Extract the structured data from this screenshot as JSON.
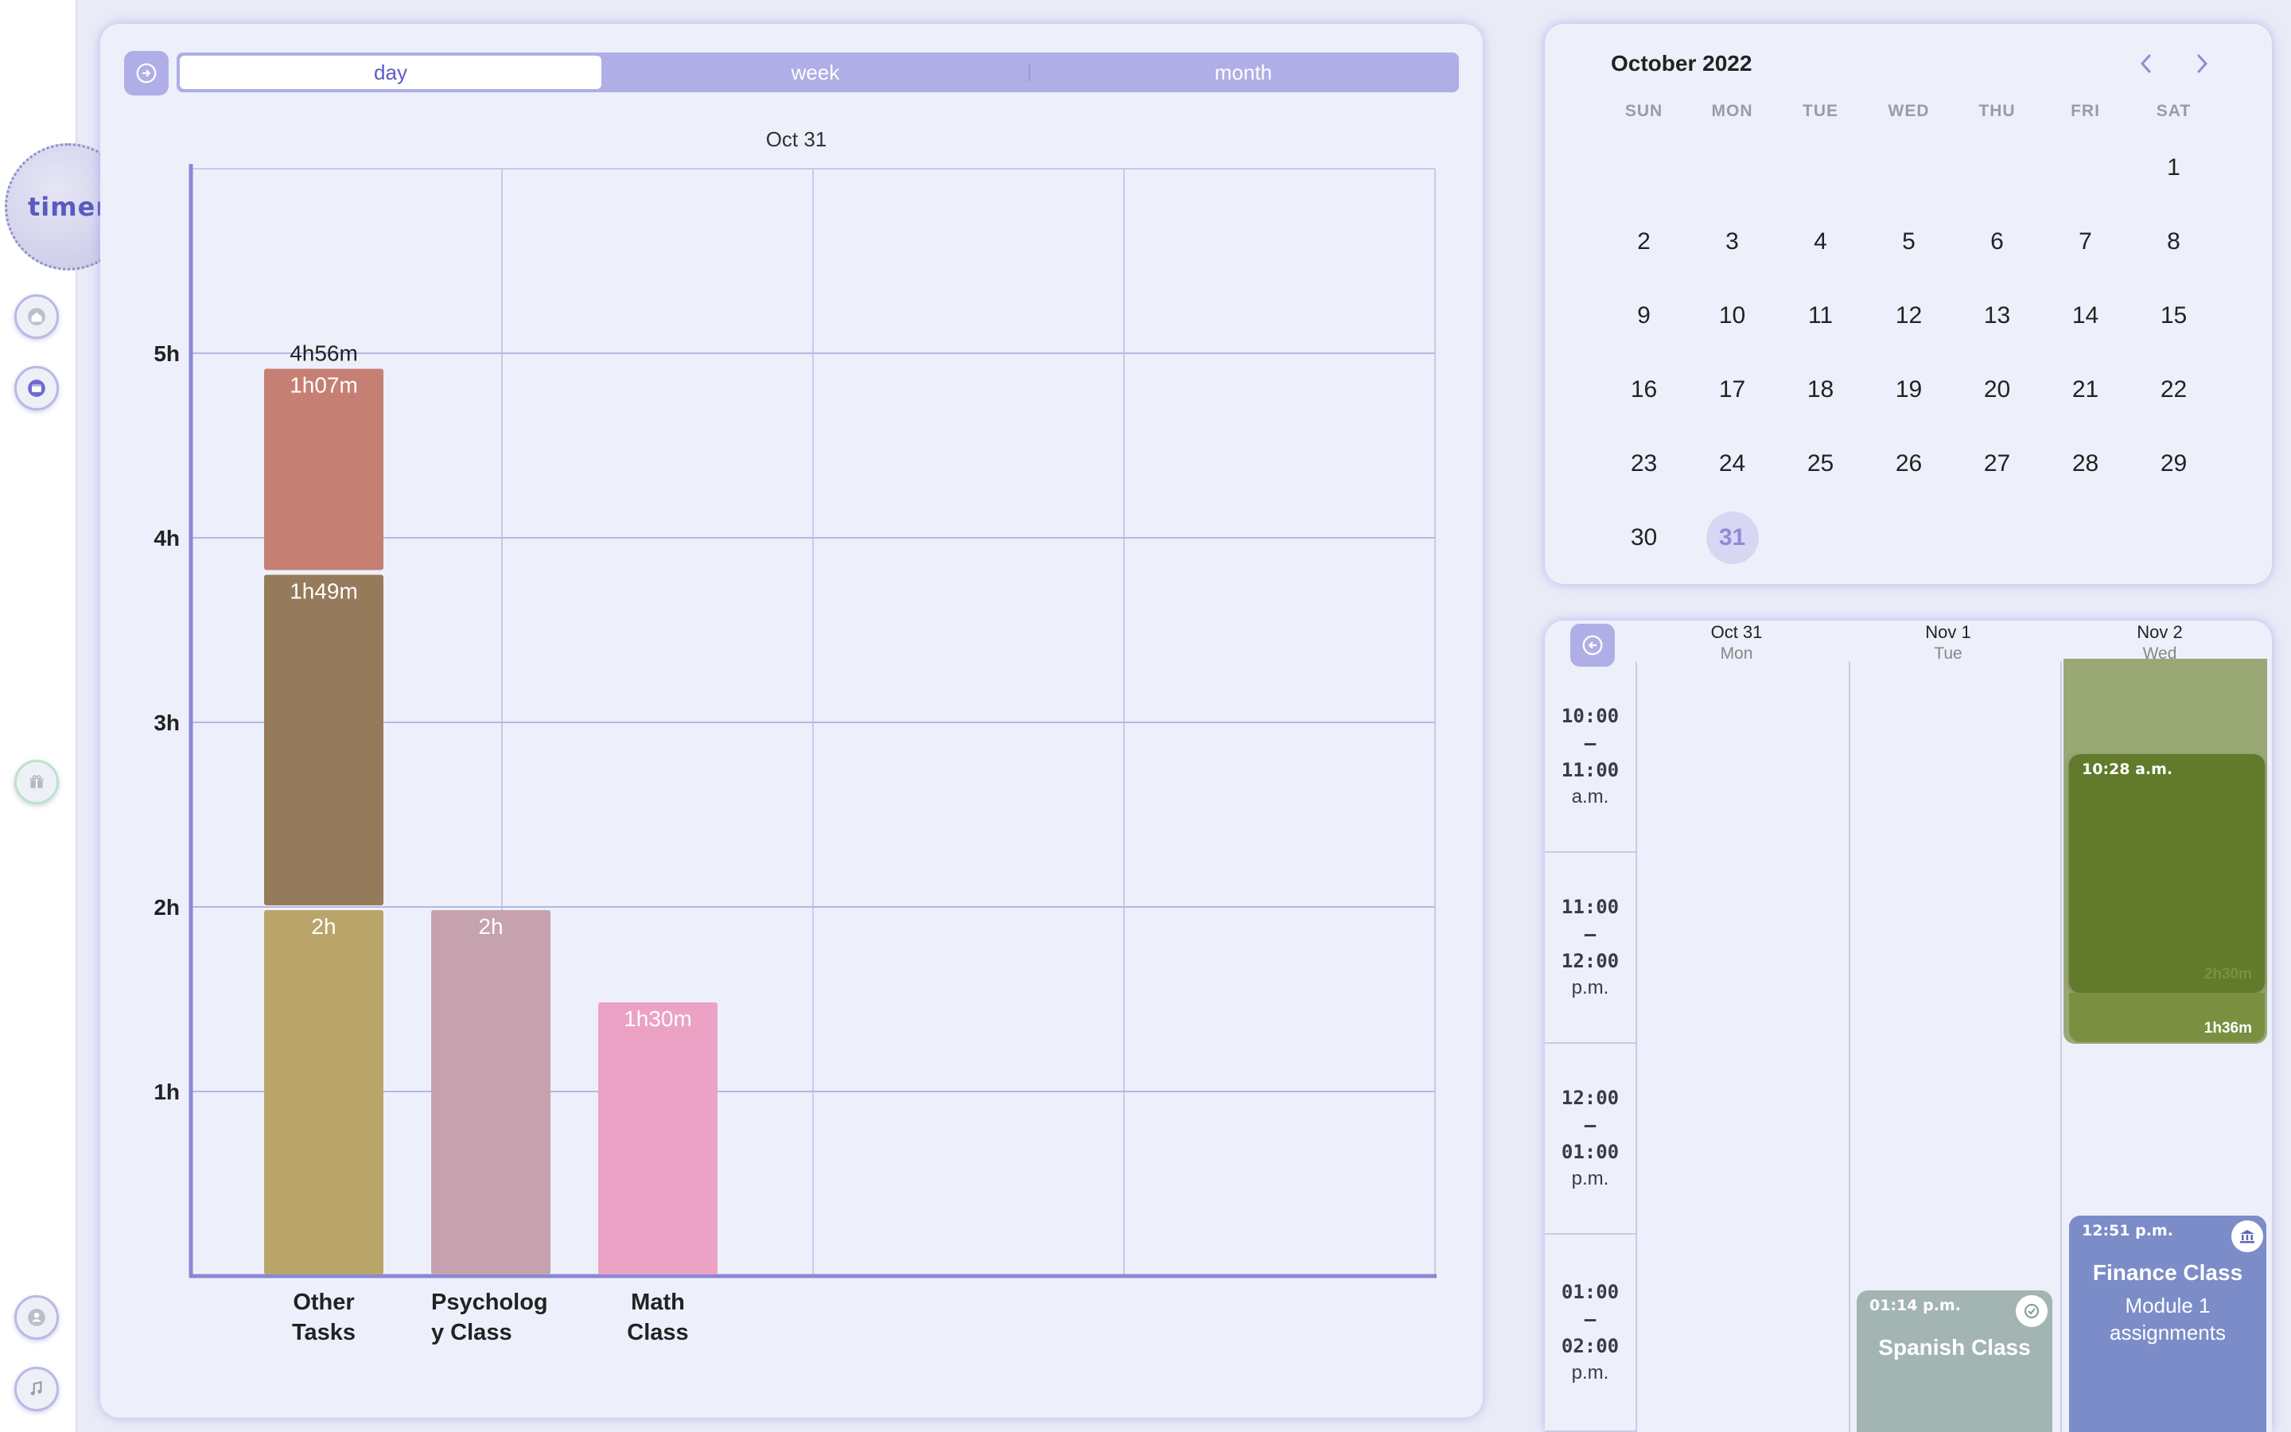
{
  "app": {
    "logo_text": "timer"
  },
  "view_tabs": [
    {
      "label": "day",
      "active": true
    },
    {
      "label": "week",
      "active": false
    },
    {
      "label": "month",
      "active": false
    }
  ],
  "chart_data": {
    "type": "bar",
    "stacked": true,
    "date_label": "Oct 31",
    "categories": [
      "Other Tasks",
      "Psychology Class",
      "Math Class"
    ],
    "category_labels": [
      [
        "Other",
        "Tasks"
      ],
      [
        "Psycholog",
        "y Class"
      ],
      [
        "Math",
        "Class"
      ]
    ],
    "ylim": [
      0,
      6
    ],
    "yticks": [
      "1h",
      "2h",
      "3h",
      "4h",
      "5h"
    ],
    "yticks_values": [
      1,
      2,
      3,
      4,
      5
    ],
    "segments": [
      {
        "category": "Other Tasks",
        "start": 0,
        "hours": 2.0,
        "label": "2h",
        "color": "#b9a56a"
      },
      {
        "category": "Other Tasks",
        "start": 2.0,
        "hours": 1.8167,
        "label": "1h49m",
        "color": "#957b5b"
      },
      {
        "category": "Other Tasks",
        "start": 3.8167,
        "hours": 1.1167,
        "label": "1h07m",
        "color": "#c57f73"
      },
      {
        "category": "Psychology Class",
        "start": 0,
        "hours": 2.0,
        "label": "2h",
        "color": "#c5a2ad"
      },
      {
        "category": "Math Class",
        "start": 0,
        "hours": 1.5,
        "label": "1h30m",
        "color": "#eba2c4"
      }
    ],
    "totals": [
      {
        "category": "Other Tasks",
        "hours": 4.9333,
        "label": "4h56m"
      }
    ],
    "grid": true
  },
  "calendar": {
    "title": "October 2022",
    "weekdays": [
      "SUN",
      "MON",
      "TUE",
      "WED",
      "THU",
      "FRI",
      "SAT"
    ],
    "leading_blanks": 6,
    "days": [
      1,
      2,
      3,
      4,
      5,
      6,
      7,
      8,
      9,
      10,
      11,
      12,
      13,
      14,
      15,
      16,
      17,
      18,
      19,
      20,
      21,
      22,
      23,
      24,
      25,
      26,
      27,
      28,
      29,
      30,
      31
    ],
    "selected_day": 31
  },
  "week": {
    "days": [
      {
        "date": "Oct 31",
        "weekday": "Mon"
      },
      {
        "date": "Nov 1",
        "weekday": "Tue"
      },
      {
        "date": "Nov 2",
        "weekday": "Wed"
      }
    ],
    "time_slots": [
      {
        "start": "10:00",
        "end": "11:00",
        "ampm": "a.m."
      },
      {
        "start": "11:00",
        "end": "12:00",
        "ampm": "p.m."
      },
      {
        "start": "12:00",
        "end": "01:00",
        "ampm": "p.m."
      },
      {
        "start": "01:00",
        "end": "02:00",
        "ampm": "p.m."
      }
    ],
    "events": [
      {
        "time": "10:28 a.m.",
        "duration": "1h36m",
        "ghost_duration": "2h30m",
        "color": "#617a2c"
      },
      {
        "time": "12:51 p.m.",
        "title": "Finance Class",
        "detail_lines": [
          "Module 1",
          "assignments"
        ],
        "color": "#7b8cc8"
      },
      {
        "time": "01:14 p.m.",
        "title": "Spanish Class",
        "color": "#a3b5b3"
      }
    ]
  }
}
